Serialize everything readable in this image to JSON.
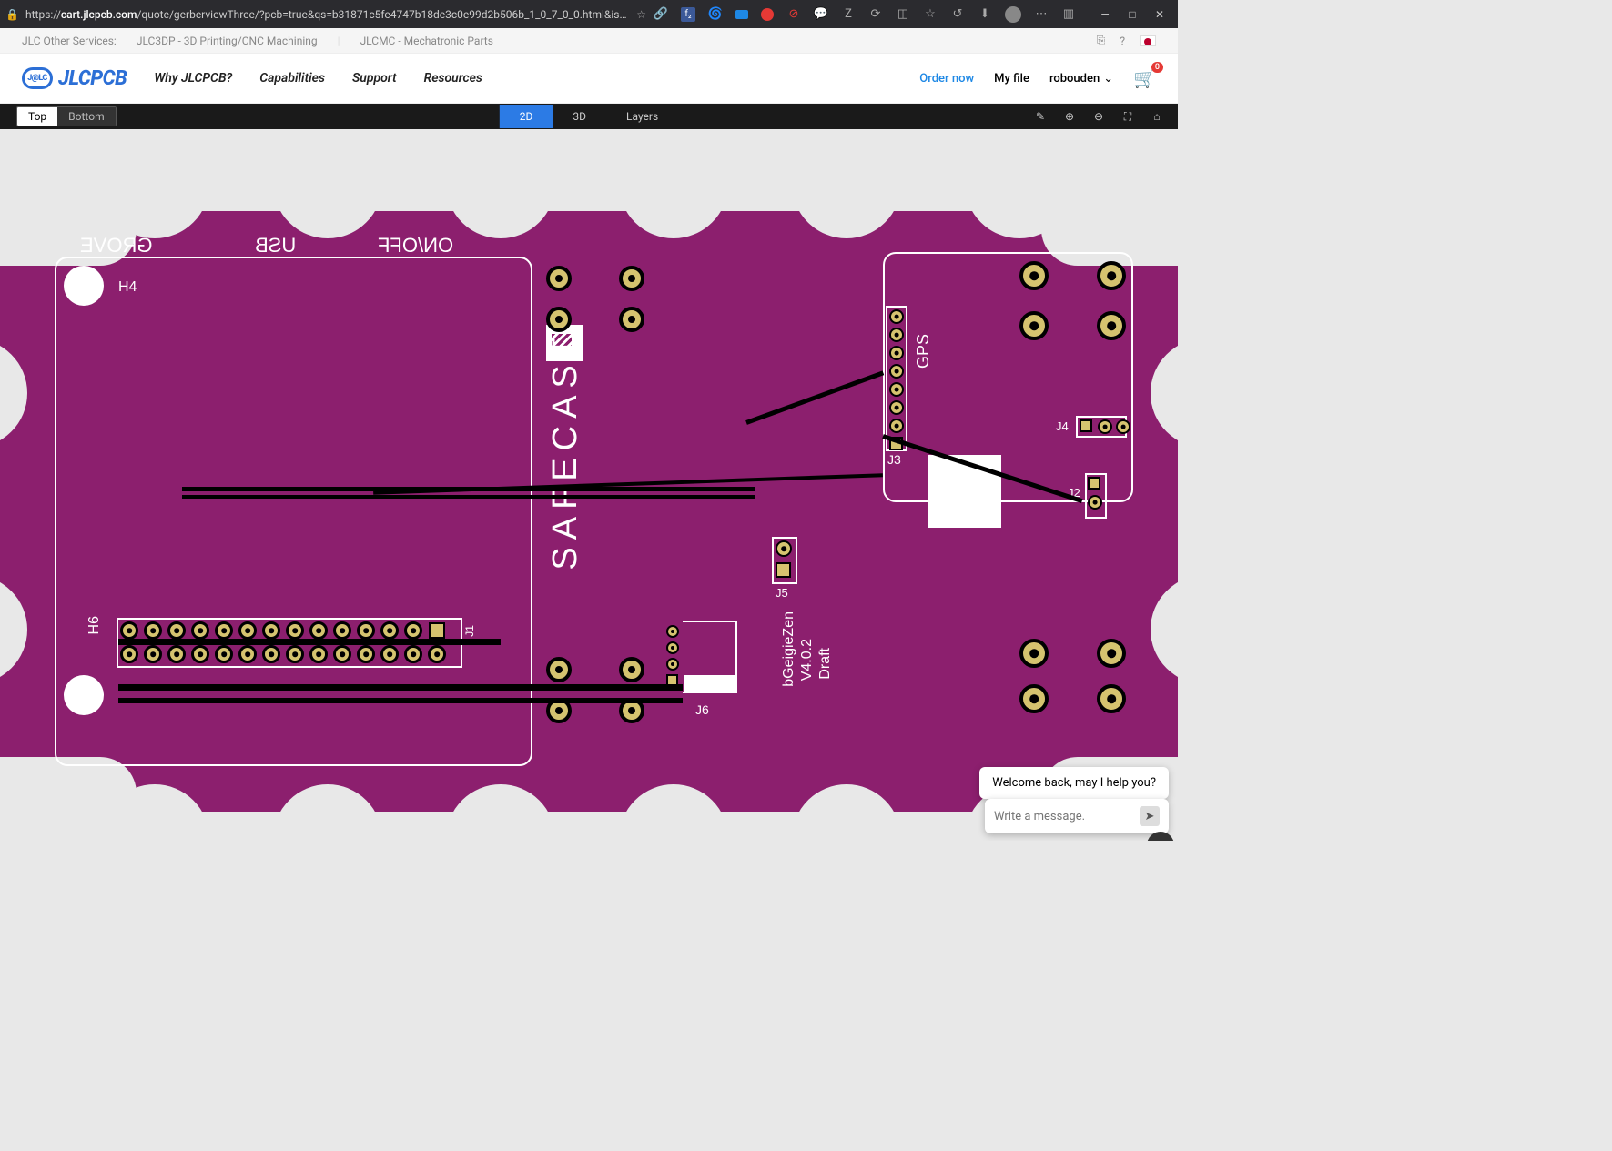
{
  "browser": {
    "url_prefix": "https://",
    "url_host": "cart.jlcpcb.com",
    "url_rest": "/quote/gerberviewThree/?pcb=true&qs=b31871c5fe4747b18de3c0e99d2b506b_1_0_7_0_0.html&isR…"
  },
  "strip": {
    "label": "JLC Other Services:",
    "link1": "JLC3DP - 3D Printing/CNC Machining",
    "link2": "JLCMC - Mechatronic Parts"
  },
  "nav": {
    "logo_small": "J@LC",
    "logo": "JLCPCB",
    "items": [
      "Why JLCPCB?",
      "Capabilities",
      "Support",
      "Resources"
    ],
    "order": "Order now",
    "myfile": "My file",
    "user": "robouden",
    "cart_count": "0"
  },
  "viewer": {
    "side_top": "Top",
    "side_bottom": "Bottom",
    "tab_2d": "2D",
    "tab_3d": "3D",
    "tab_layers": "Layers"
  },
  "pcb": {
    "silk": {
      "grove": "GROVE",
      "usb": "USB",
      "onoff": "ON/OFF",
      "gps": "GPS",
      "h4": "H4",
      "h6": "H6",
      "j1": "J1",
      "j2": "J2",
      "j3": "J3",
      "j4": "J4",
      "j5": "J5",
      "j6": "J6",
      "brand": "SAFECAST",
      "ver_line1": "bGeigieZen",
      "ver_line2": "V4.0.2",
      "ver_line3": "Draft"
    }
  },
  "chat": {
    "msg": "Welcome back, may I help you?",
    "placeholder": "Write a message…"
  }
}
